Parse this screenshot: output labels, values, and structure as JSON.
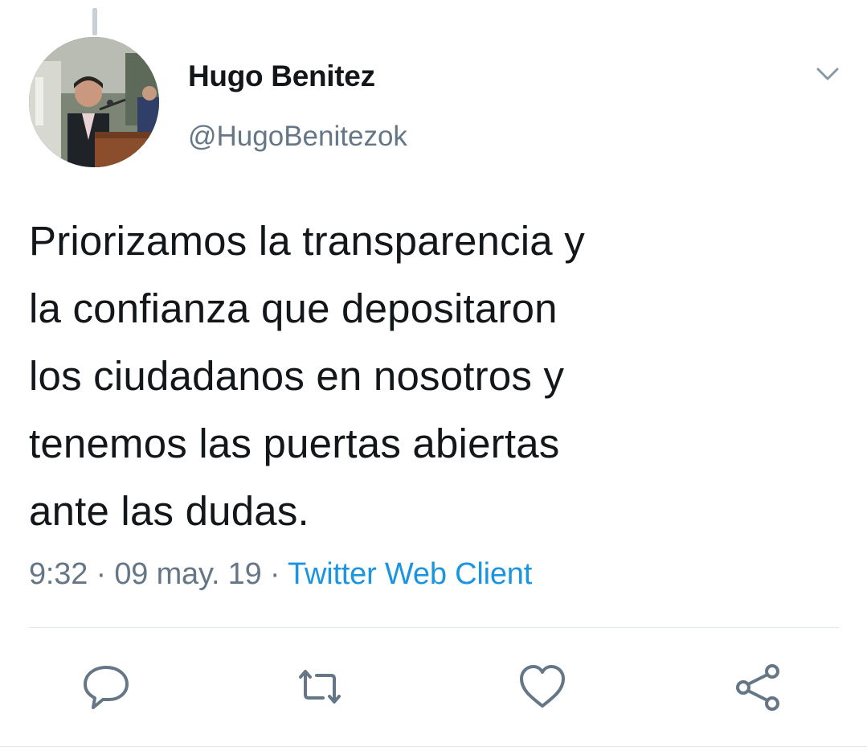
{
  "tweet": {
    "author": {
      "display_name": "Hugo Benitez",
      "handle": "@HugoBenitezok"
    },
    "text_lines": [
      "Priorizamos la transparencia y",
      "la confianza que depositaron",
      "los ciudadanos en nosotros y",
      "tenemos las puertas abiertas",
      "ante las dudas."
    ],
    "time": "9:32",
    "separator": "·",
    "date": "09 may. 19",
    "source": "Twitter Web Client"
  },
  "icons": {
    "menu": "chevron-down-icon",
    "reply": "speech-bubble-icon",
    "retweet": "retweet-arrows-icon",
    "like": "heart-icon",
    "share": "share-nodes-icon"
  },
  "colors": {
    "text": "#14171a",
    "secondary": "#657786",
    "link": "#1b95e0",
    "divider": "#e1e8ed"
  }
}
